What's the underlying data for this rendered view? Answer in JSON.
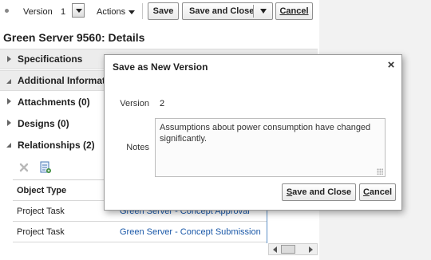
{
  "toolbar": {
    "version_label": "Version",
    "version_value": "1",
    "actions_label": "Actions",
    "save_label": "Save",
    "save_and_close_label": "Save and Close",
    "cancel_label": "Cancel"
  },
  "page": {
    "title": "Green Server 9560: Details"
  },
  "sections": {
    "specifications": "Specifications",
    "additional_info": "Additional Informati",
    "attachments": "Attachments (0)",
    "designs": "Designs (0)",
    "relationships": "Relationships (2)"
  },
  "relationships_table": {
    "column_object_type": "Object Type",
    "rows": [
      {
        "object_type": "Project Task",
        "name": "Green Server - Concept Approval"
      },
      {
        "object_type": "Project Task",
        "name": "Green Server - Concept Submission"
      }
    ]
  },
  "dialog": {
    "title": "Save as New Version",
    "close_glyph": "×",
    "version_label": "Version",
    "version_value": "2",
    "notes_label": "Notes",
    "notes_value": "Assumptions about power consumption have changed significantly.",
    "save_and_close_label": "Save and Close",
    "cancel_label": "Cancel"
  },
  "colors": {
    "link": "#1a58a8",
    "table_divider": "#5b8fc6",
    "section_shade": "#ececec"
  },
  "icons": {
    "delete": "x-icon",
    "add": "add-document-icon",
    "expand": "triangle-right-icon",
    "collapse": "triangle-down-icon",
    "close": "close-icon"
  }
}
